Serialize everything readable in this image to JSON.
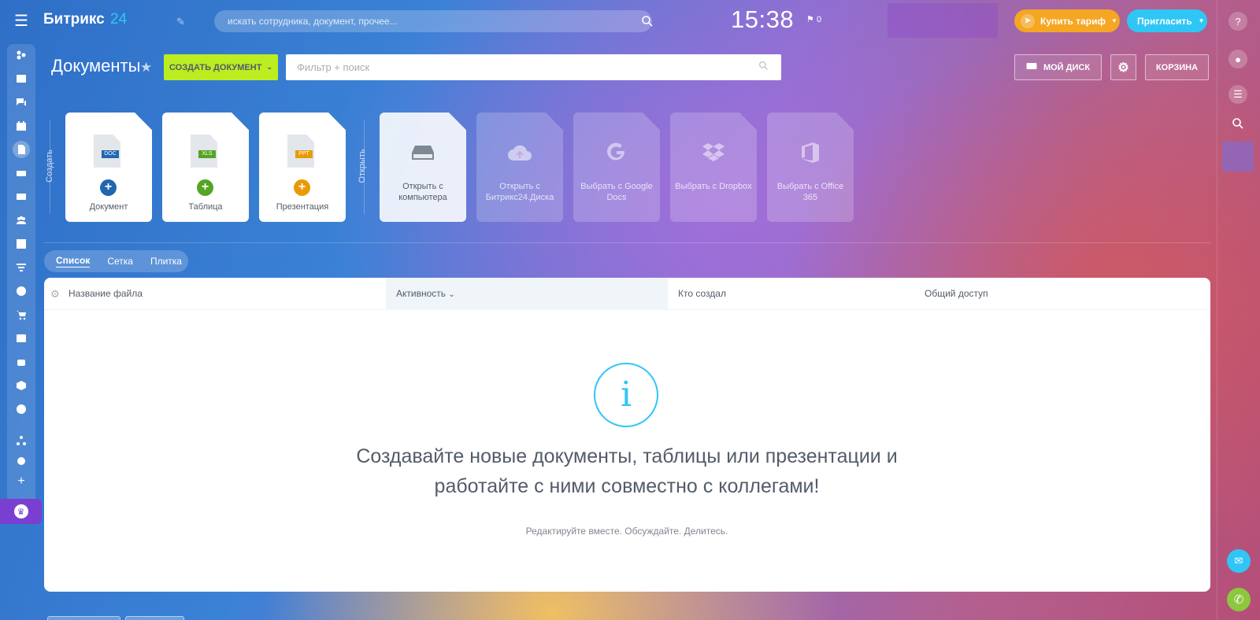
{
  "header": {
    "logo_text": "Битрикс",
    "logo_num": "24",
    "search_placeholder": "искать сотрудника, документ, прочее...",
    "clock": "15:38",
    "flag_count": "0",
    "buy_label": "Купить тариф",
    "invite_label": "Пригласить"
  },
  "page": {
    "title": "Документы",
    "create_label": "СОЗДАТЬ ДОКУМЕНТ",
    "filter_placeholder": "Фильтр + поиск",
    "mydisk_label": "МОЙ ДИСК",
    "trash_label": "КОРЗИНА"
  },
  "create_section": {
    "label": "Создать",
    "tiles": [
      {
        "label": "Документ",
        "tag": "DOC",
        "color": "#2067b0"
      },
      {
        "label": "Таблица",
        "tag": "XLS",
        "color": "#56a424"
      },
      {
        "label": "Презентация",
        "tag": "PPT",
        "color": "#e89b06"
      }
    ]
  },
  "open_section": {
    "label": "Открыть",
    "tiles": [
      {
        "label": "Открыть с компьютера",
        "icon": "hard-drive-icon"
      },
      {
        "label": "Открыть с Битрикс24.Диска",
        "icon": "cloud-upload-icon"
      },
      {
        "label": "Выбрать с Google Docs",
        "icon": "google-icon"
      },
      {
        "label": "Выбрать с Dropbox",
        "icon": "dropbox-icon"
      },
      {
        "label": "Выбрать с Office 365",
        "icon": "office-icon"
      }
    ]
  },
  "view_tabs": [
    "Список",
    "Сетка",
    "Плитка"
  ],
  "table": {
    "columns": [
      "Название файла",
      "Активность",
      "Кто создал",
      "Общий доступ"
    ],
    "empty_title": "Создавайте новые документы, таблицы или презентации и работайте с ними совместно с коллегами!",
    "empty_subtitle": "Редактируйте вместе. Обсуждайте. Делитесь."
  },
  "colors": {
    "accent_green": "#bbed21",
    "accent_blue": "#2fc6f6",
    "accent_orange": "#f5a623"
  }
}
